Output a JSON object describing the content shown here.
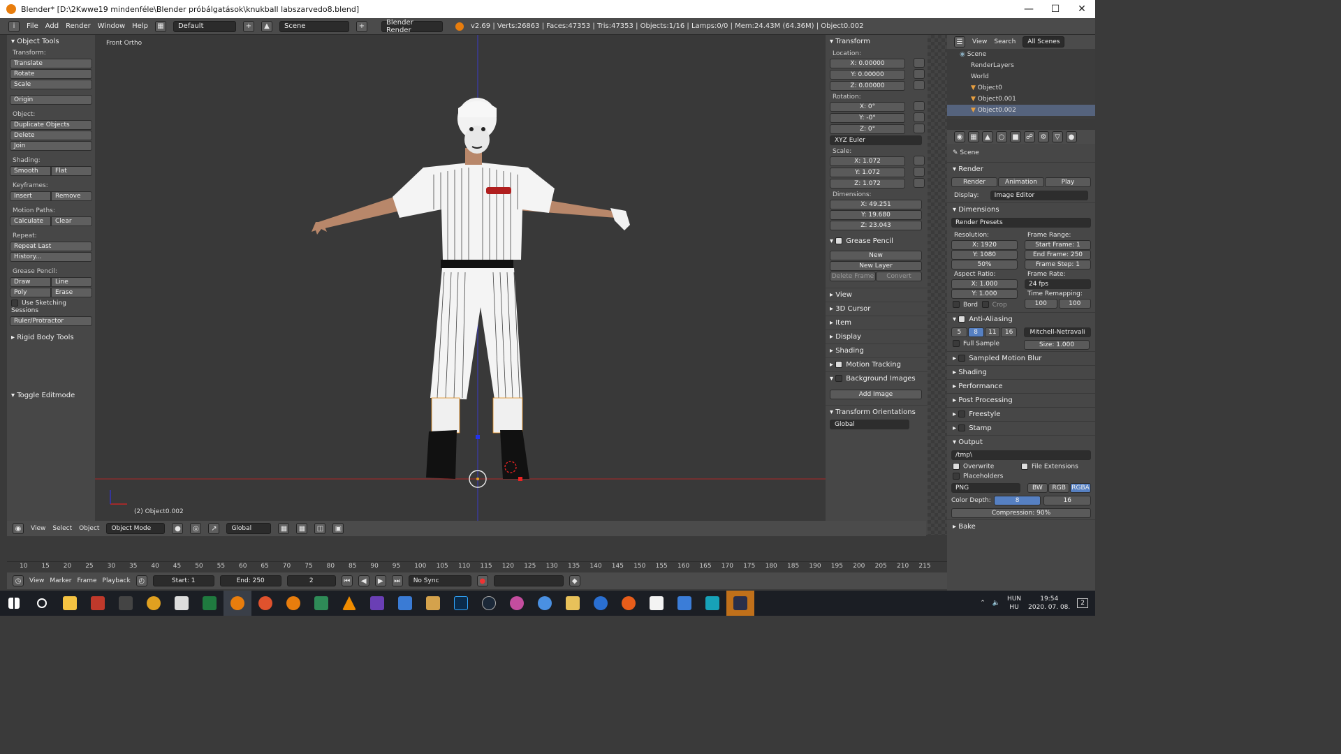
{
  "titlebar": {
    "title": "Blender* [D:\\2Kwwe19 mindenféle\\Blender próbálgatások\\knukball labszarvedo8.blend]"
  },
  "topbar": {
    "menus": [
      "File",
      "Add",
      "Render",
      "Window",
      "Help"
    ],
    "layout": "Default",
    "scene": "Scene",
    "engine": "Blender Render",
    "stats": "v2.69 | Verts:26863 | Faces:47353 | Tris:47353 | Objects:1/16 | Lamps:0/0 | Mem:24.43M (64.36M) | Object0.002"
  },
  "tools": {
    "header": "Object Tools",
    "transform_label": "Transform:",
    "translate": "Translate",
    "rotate": "Rotate",
    "scale": "Scale",
    "origin": "Origin",
    "object_label": "Object:",
    "duplicate": "Duplicate Objects",
    "delete": "Delete",
    "join": "Join",
    "shading_label": "Shading:",
    "smooth": "Smooth",
    "flat": "Flat",
    "keyframes_label": "Keyframes:",
    "insert": "Insert",
    "remove": "Remove",
    "motion_label": "Motion Paths:",
    "calculate": "Calculate",
    "clear": "Clear",
    "repeat_label": "Repeat:",
    "repeat_last": "Repeat Last",
    "history": "History...",
    "grease_label": "Grease Pencil:",
    "draw": "Draw",
    "line": "Line",
    "poly": "Poly",
    "erase": "Erase",
    "sketching": "Use Sketching Sessions",
    "ruler": "Ruler/Protractor",
    "rigid": "Rigid Body Tools",
    "toggle_edit": "Toggle Editmode"
  },
  "viewport": {
    "label": "Front Ortho",
    "object": "(2) Object0.002"
  },
  "npanel": {
    "transform": "Transform",
    "location": "Location:",
    "loc": [
      "X: 0.00000",
      "Y: 0.00000",
      "Z: 0.00000"
    ],
    "rotation": "Rotation:",
    "rot": [
      "X: 0°",
      "Y: -0°",
      "Z: 0°"
    ],
    "euler": "XYZ Euler",
    "scale": "Scale:",
    "scl": [
      "X: 1.072",
      "Y: 1.072",
      "Z: 1.072"
    ],
    "dimensions": "Dimensions:",
    "dim": [
      "X: 49.251",
      "Y: 19.680",
      "Z: 23.043"
    ],
    "grease": "Grease Pencil",
    "new": "New",
    "new_layer": "New Layer",
    "delete_frame": "Delete Frame",
    "convert": "Convert",
    "collapsed": [
      "View",
      "3D Cursor",
      "Item",
      "Display",
      "Shading",
      "Motion Tracking",
      "Background Images"
    ],
    "add_image": "Add Image",
    "orient": "Transform Orientations",
    "global": "Global"
  },
  "outliner": {
    "view": "View",
    "search": "Search",
    "all_scenes": "All Scenes",
    "items": [
      "Scene",
      "RenderLayers",
      "World",
      "Object0",
      "Object0.001",
      "Object0.002"
    ]
  },
  "props": {
    "scene": "Scene",
    "render": "Render",
    "render_btn": "Render",
    "animation_btn": "Animation",
    "play_btn": "Play",
    "display_label": "Display:",
    "display_value": "Image Editor",
    "dimensions": "Dimensions",
    "presets": "Render Presets",
    "resolution": "Resolution:",
    "res_x": "X: 1920",
    "res_y": "Y: 1080",
    "res_pct": "50%",
    "frame_range": "Frame Range:",
    "start_frame": "Start Frame: 1",
    "end_frame": "End Frame: 250",
    "frame_step": "Frame Step: 1",
    "aspect": "Aspect Ratio:",
    "asp_x": "X: 1.000",
    "asp_y": "Y: 1.000",
    "frame_rate": "Frame Rate:",
    "fps": "24 fps",
    "time_remap": "Time Remapping:",
    "remap_old": "100",
    "remap_new": "100",
    "bord": "Bord",
    "crop": "Crop",
    "aa": "Anti-Aliasing",
    "aa_samples": [
      "5",
      "8",
      "11",
      "16"
    ],
    "filter": "Mitchell-Netravali",
    "full_sample": "Full Sample",
    "size": "Size: 1.000",
    "sampled_mb": "Sampled Motion Blur",
    "shading": "Shading",
    "performance": "Performance",
    "post": "Post Processing",
    "freestyle": "Freestyle",
    "stamp": "Stamp",
    "output": "Output",
    "path": "/tmp\\",
    "overwrite": "Overwrite",
    "file_ext": "File Extensions",
    "placeholders": "Placeholders",
    "format": "PNG",
    "bw": "BW",
    "rgb": "RGB",
    "rgba": "RGBA",
    "color_depth": "Color Depth:",
    "depth8": "8",
    "depth16": "16",
    "compression": "Compression: 90%",
    "bake": "Bake"
  },
  "vheader": {
    "view": "View",
    "select": "Select",
    "object": "Object",
    "mode": "Object Mode",
    "orient": "Global"
  },
  "timeline": {
    "ticks": [
      "10",
      "15",
      "20",
      "25",
      "30",
      "35",
      "40",
      "45",
      "50",
      "55",
      "60",
      "65",
      "70",
      "75",
      "80",
      "85",
      "90",
      "95",
      "100",
      "105",
      "110",
      "115",
      "120",
      "125",
      "130",
      "135",
      "140",
      "145",
      "150",
      "155",
      "160",
      "165",
      "170",
      "175",
      "180",
      "185",
      "190",
      "195",
      "200",
      "205",
      "210",
      "215"
    ],
    "view": "View",
    "marker": "Marker",
    "frame": "Frame",
    "playback": "Playback",
    "start": "Start: 1",
    "end": "End: 250",
    "current": "2",
    "sync": "No Sync"
  },
  "taskbar": {
    "lang1": "HUN",
    "lang2": "HU",
    "time": "19:54",
    "date": "2020. 07. 08.",
    "notif": "2",
    "icons": [
      "windows-icon",
      "search-icon",
      "explorer-icon",
      "app-icon",
      "app-icon",
      "chrome-icon",
      "7zip-icon",
      "excel-icon",
      "blender-icon",
      "maps-icon",
      "blender-icon",
      "spreadsheet-icon",
      "vlc-icon",
      "app-icon",
      "app-icon",
      "folder-icon",
      "photoshop-icon",
      "steam-icon",
      "app-icon",
      "app-icon",
      "app-icon",
      "app-icon",
      "app-icon",
      "app-icon",
      "app-icon",
      "app-icon"
    ]
  }
}
